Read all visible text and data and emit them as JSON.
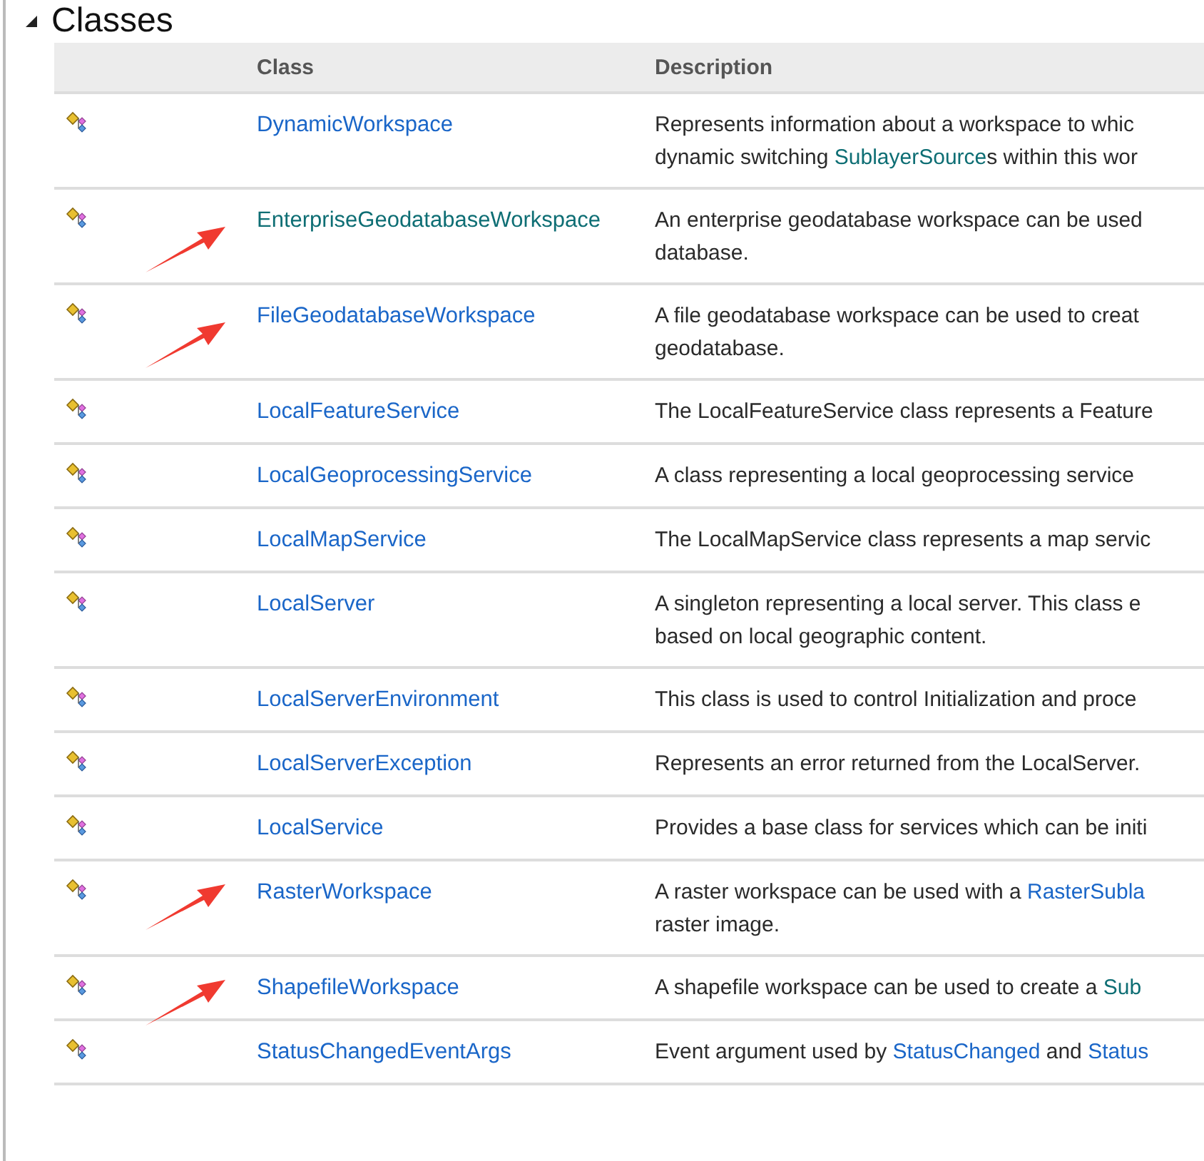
{
  "section": {
    "title": "Classes",
    "expanded": true
  },
  "table": {
    "columns": [
      "Class",
      "Description"
    ],
    "rows": [
      {
        "name": "DynamicWorkspace",
        "visited": false,
        "arrow": false,
        "description": [
          [
            {
              "text": "Represents information about a workspace to whic"
            }
          ],
          [
            {
              "text": "dynamic switching "
            },
            {
              "text": "SublayerSource",
              "link": true,
              "visited": true
            },
            {
              "text": "s within this wor"
            }
          ]
        ]
      },
      {
        "name": "EnterpriseGeodatabaseWorkspace",
        "visited": true,
        "arrow": true,
        "description": [
          [
            {
              "text": "An enterprise geodatabase workspace can be used"
            }
          ],
          [
            {
              "text": "database."
            }
          ]
        ]
      },
      {
        "name": "FileGeodatabaseWorkspace",
        "visited": false,
        "arrow": true,
        "description": [
          [
            {
              "text": "A file geodatabase workspace can be used to creat"
            }
          ],
          [
            {
              "text": "geodatabase."
            }
          ]
        ]
      },
      {
        "name": "LocalFeatureService",
        "visited": false,
        "arrow": false,
        "description": [
          [
            {
              "text": "The LocalFeatureService class represents a Feature"
            }
          ]
        ]
      },
      {
        "name": "LocalGeoprocessingService",
        "visited": false,
        "arrow": false,
        "description": [
          [
            {
              "text": "A class representing a local geoprocessing service"
            }
          ]
        ]
      },
      {
        "name": "LocalMapService",
        "visited": false,
        "arrow": false,
        "description": [
          [
            {
              "text": "The LocalMapService class represents a map servic"
            }
          ]
        ]
      },
      {
        "name": "LocalServer",
        "visited": false,
        "arrow": false,
        "description": [
          [
            {
              "text": "A singleton representing a local server. This class e"
            }
          ],
          [
            {
              "text": "based on local geographic content."
            }
          ]
        ]
      },
      {
        "name": "LocalServerEnvironment",
        "visited": false,
        "arrow": false,
        "description": [
          [
            {
              "text": "This class is used to control Initialization and proce"
            }
          ]
        ]
      },
      {
        "name": "LocalServerException",
        "visited": false,
        "arrow": false,
        "description": [
          [
            {
              "text": "Represents an error returned from the LocalServer."
            }
          ]
        ]
      },
      {
        "name": "LocalService",
        "visited": false,
        "arrow": false,
        "description": [
          [
            {
              "text": "Provides a base class for services which can be initi"
            }
          ]
        ]
      },
      {
        "name": "RasterWorkspace",
        "visited": false,
        "arrow": true,
        "description": [
          [
            {
              "text": "A raster workspace can be used with a "
            },
            {
              "text": "RasterSubla",
              "link": true,
              "visited": false
            }
          ],
          [
            {
              "text": "raster image."
            }
          ]
        ]
      },
      {
        "name": "ShapefileWorkspace",
        "visited": false,
        "arrow": true,
        "description": [
          [
            {
              "text": "A shapefile workspace can be used to create a "
            },
            {
              "text": "Sub",
              "link": true,
              "visited": true
            }
          ]
        ]
      },
      {
        "name": "StatusChangedEventArgs",
        "visited": false,
        "arrow": false,
        "description": [
          [
            {
              "text": "Event argument used by "
            },
            {
              "text": "StatusChanged",
              "link": true,
              "visited": false
            },
            {
              "text": " and "
            },
            {
              "text": "Status",
              "link": true,
              "visited": false
            }
          ]
        ]
      }
    ]
  }
}
